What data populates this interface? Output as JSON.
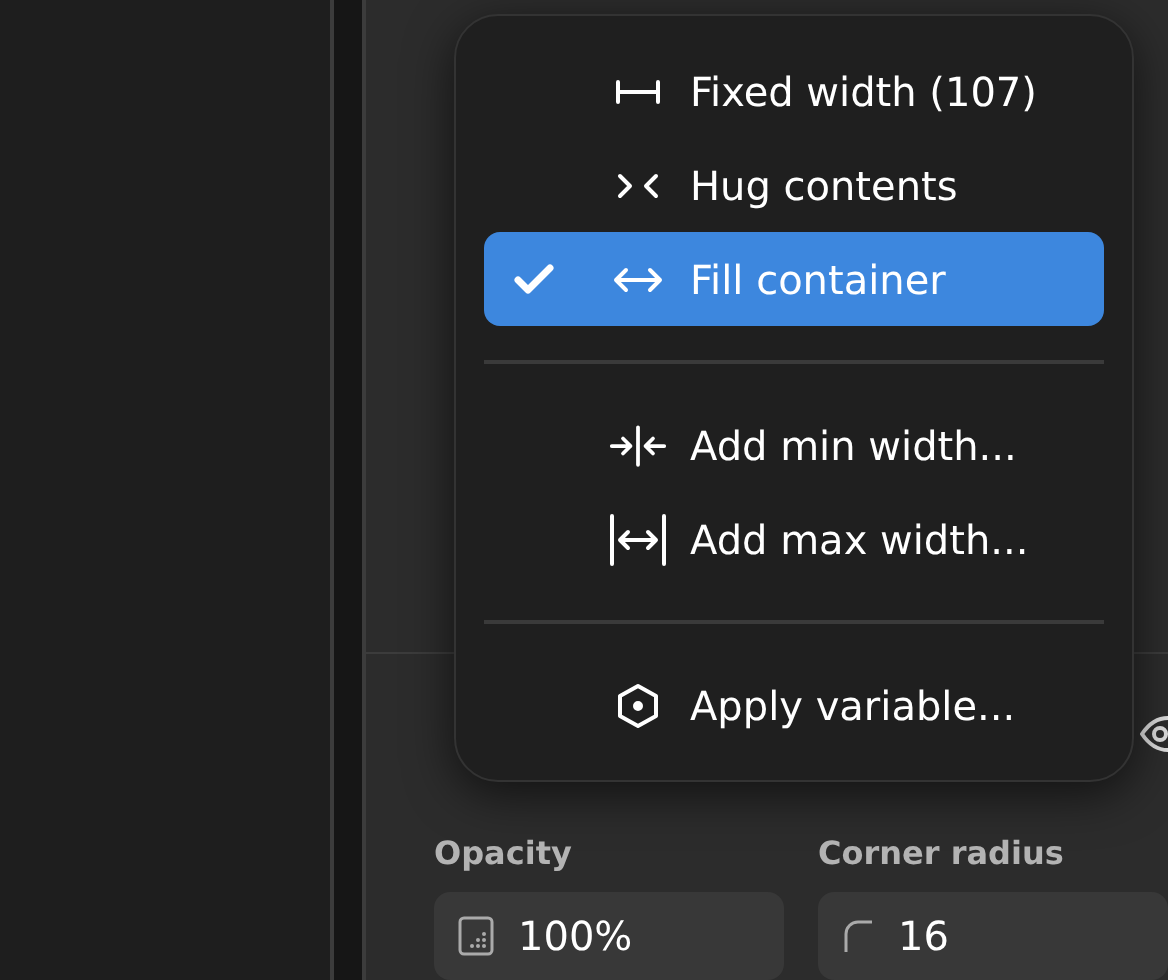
{
  "panel": {
    "fields": [
      {
        "label": "Opacity",
        "value": "100%",
        "kind": "opacity"
      },
      {
        "label": "Corner radius",
        "value": "16",
        "kind": "corner"
      }
    ]
  },
  "menu": {
    "groups": [
      [
        {
          "label": "Fixed width (107)",
          "kind": "fixed",
          "selected": false
        },
        {
          "label": "Hug contents",
          "kind": "hug",
          "selected": false
        },
        {
          "label": "Fill container",
          "kind": "fill",
          "selected": true
        }
      ],
      [
        {
          "label": "Add min width...",
          "kind": "min",
          "selected": false
        },
        {
          "label": "Add max width...",
          "kind": "max",
          "selected": false
        }
      ],
      [
        {
          "label": "Apply variable...",
          "kind": "variable",
          "selected": false
        }
      ]
    ]
  }
}
